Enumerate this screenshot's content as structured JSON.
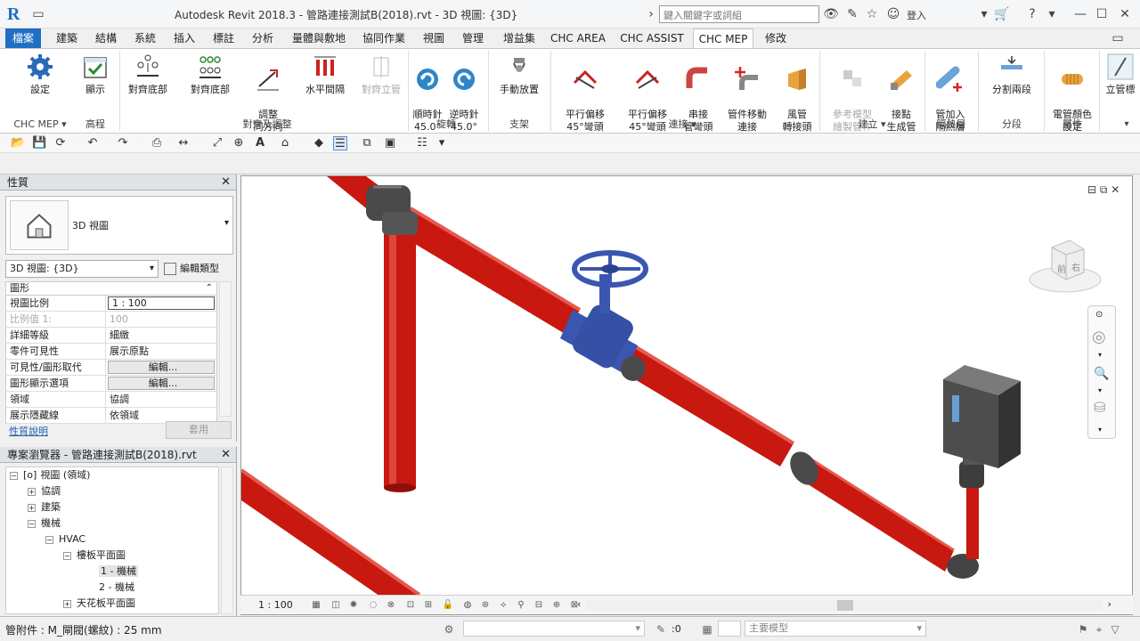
{
  "window": {
    "app_logo": "R",
    "title": "Autodesk Revit 2018.3 -   管路連接測試B(2018).rvt - 3D 視圖: {3D}",
    "search_placeholder": "鍵入關鍵字或詞組",
    "login_label": "登入"
  },
  "tabs": [
    {
      "label": "檔案"
    },
    {
      "label": "建築"
    },
    {
      "label": "結構"
    },
    {
      "label": "系統"
    },
    {
      "label": "插入"
    },
    {
      "label": "標註"
    },
    {
      "label": "分析"
    },
    {
      "label": "量體與敷地"
    },
    {
      "label": "協同作業"
    },
    {
      "label": "視圖"
    },
    {
      "label": "管理"
    },
    {
      "label": "增益集"
    },
    {
      "label": "CHC AREA"
    },
    {
      "label": "CHC ASSIST"
    },
    {
      "label": "CHC MEP"
    },
    {
      "label": "修改"
    }
  ],
  "ribbon": {
    "buttons": {
      "settings": "設定",
      "display": "顯示",
      "align_bottom_1": "對齊底部",
      "align_bottom_2": "對齊底部",
      "adjust_direction": "調整\n同方向",
      "horizontal_spacing": "水平間隔",
      "align_vertical": "對齊立管",
      "rotate_cw": "順時針\n45.0°",
      "rotate_ccw": "逆時針\n45.0°",
      "manual_place": "手動放置",
      "parallel_offset_1": "平行偏移\n45°彎頭",
      "parallel_offset_2": "平行偏移\n45°彎頭",
      "series_elbow": "串接\n管彎頭",
      "move_fitting": "管件移動\n連接",
      "duct_elbow": "風管\n轉接頭",
      "reference_model": "參考模型\n繪製管件",
      "connect_point": "接點\n生成管",
      "add_insulation": "管加入\n隔熱層",
      "split_two": "分割兩段",
      "conduit_color": "電管顏色\n設定",
      "elevation": "立管標"
    },
    "groups": {
      "chc_mep": "CHC MEP",
      "elevation": "高程",
      "align_adjust": "對齊及調整",
      "rotate": "旋轉",
      "support": "支架",
      "connect": "連接",
      "build": "建立",
      "insulation": "隔熱層",
      "segment": "分段",
      "property": "屬性"
    }
  },
  "properties": {
    "header": "性質",
    "type_name": "3D 視圖",
    "view_dropdown": "3D 視圖: {3D}",
    "edit_type": "編輯類型",
    "section": "圖形",
    "rows": [
      {
        "name": "視圖比例",
        "value": "1 : 100"
      },
      {
        "name": "比例值 1:",
        "value": "100"
      },
      {
        "name": "詳細等級",
        "value": "細緻"
      },
      {
        "name": "零件可見性",
        "value": "展示原點"
      },
      {
        "name": "可見性/圖形取代",
        "value": "編輯..."
      },
      {
        "name": "圖形顯示選項",
        "value": "編輯..."
      },
      {
        "name": "領域",
        "value": "協調"
      },
      {
        "name": "展示隱藏線",
        "value": "依領域"
      }
    ],
    "help_link": "性質說明",
    "apply": "套用"
  },
  "browser": {
    "header": "專案瀏覽器 - 管路連接測試B(2018).rvt",
    "items": [
      {
        "label": "視圖 (領域)",
        "toggle": "−"
      },
      {
        "label": "協調",
        "toggle": "+"
      },
      {
        "label": "建築",
        "toggle": "+"
      },
      {
        "label": "機械",
        "toggle": "−"
      },
      {
        "label": "HVAC",
        "toggle": "−"
      },
      {
        "label": "樓板平面圖",
        "toggle": "−"
      },
      {
        "label": "1 - 機械",
        "toggle": ""
      },
      {
        "label": "2 - 機械",
        "toggle": ""
      },
      {
        "label": "天花板平面圖",
        "toggle": "+"
      }
    ]
  },
  "viewcube": {
    "face_front": "前",
    "face_right": "右"
  },
  "viewbar": {
    "scale": "1 : 100"
  },
  "status": {
    "text": "管附件 : M_閘閥(螺紋) : 25 mm",
    "filter_count": ":0",
    "model_field": "主要模型"
  },
  "colors": {
    "accent": "#1f6fc5",
    "pipe_red": "#d11a12",
    "valve_blue": "#3b56b0",
    "fitting_gray": "#4a4a4a"
  }
}
